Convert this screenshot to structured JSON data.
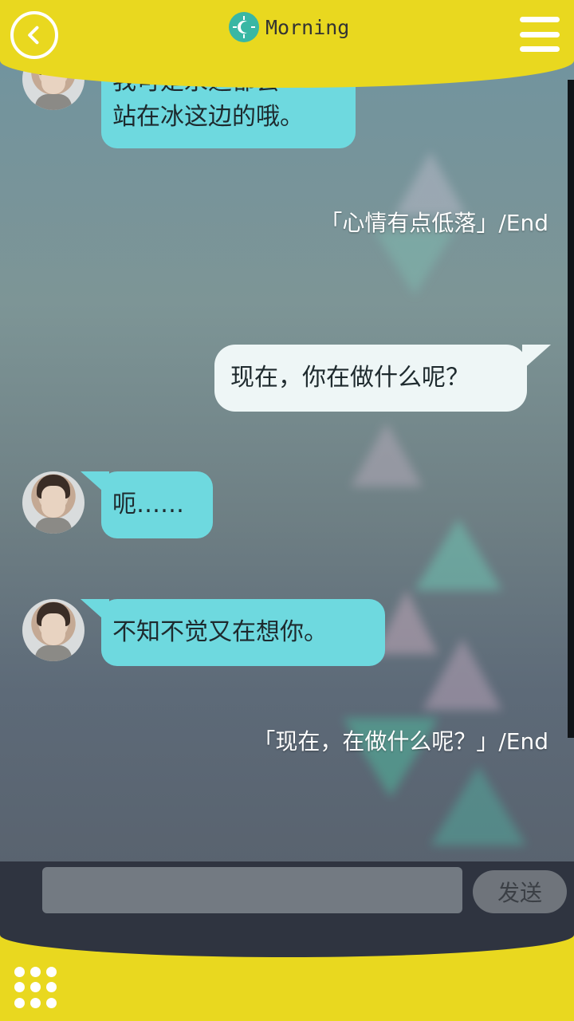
{
  "header": {
    "title": "Morning",
    "back_icon": "chevron-left-icon",
    "status_icon": "sun-icon",
    "menu_icon": "hamburger-menu-icon",
    "accent_color": "#e9d81f"
  },
  "messages": [
    {
      "side": "incoming",
      "lines": [
        "我可是永远都会",
        "站在冰这边的哦。"
      ]
    },
    {
      "side": "note",
      "text": "「心情有点低落」/End"
    },
    {
      "side": "outgoing",
      "text": "现在，你在做什么呢？"
    },
    {
      "side": "incoming",
      "text": "呃……"
    },
    {
      "side": "incoming",
      "text": "不知不觉又在想你。"
    },
    {
      "side": "note",
      "text": "「现在，在做什么呢？」/End"
    }
  ],
  "input": {
    "value": "",
    "send_label": "发送"
  },
  "footer": {
    "grid_icon": "apps-grid-icon"
  },
  "colors": {
    "incoming_bubble": "#6ed9df",
    "outgoing_bubble": "#eef6f6",
    "input_bar": "#2f3440"
  }
}
